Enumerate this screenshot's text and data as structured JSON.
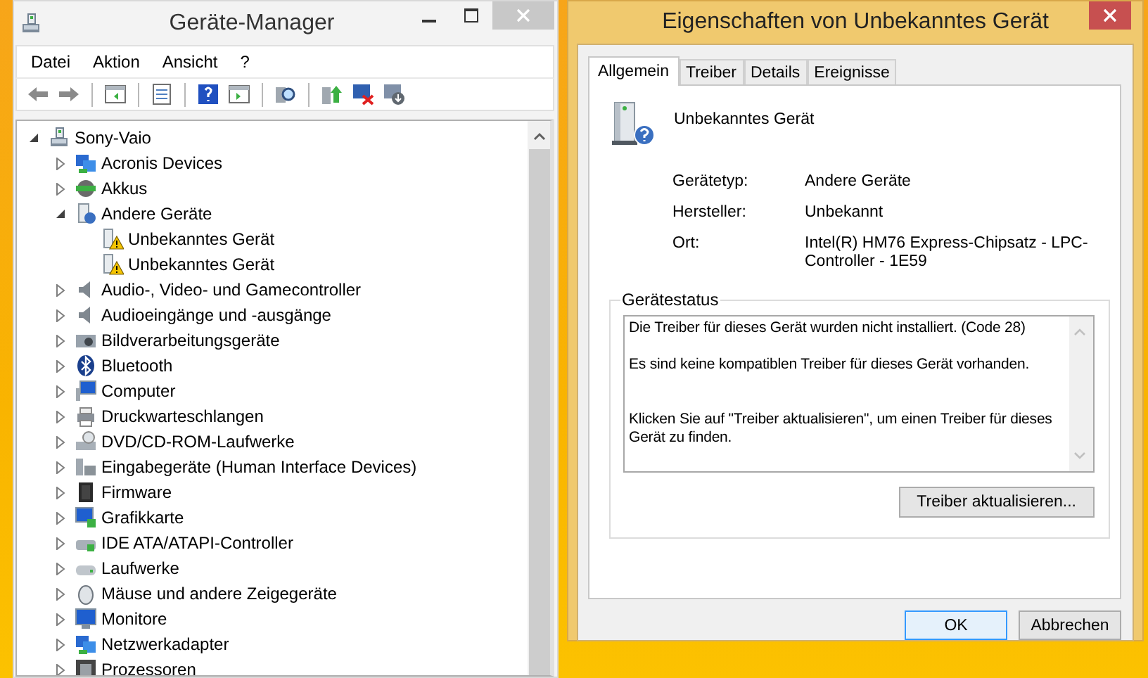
{
  "device_manager": {
    "title": "Geräte-Manager",
    "menu": [
      "Datei",
      "Aktion",
      "Ansicht",
      "?"
    ],
    "tree": [
      {
        "label": "Sony-Vaio",
        "expanded": true,
        "children": [
          {
            "label": "Acronis Devices",
            "expanded": false
          },
          {
            "label": "Akkus",
            "expanded": false
          },
          {
            "label": "Andere Geräte",
            "expanded": true,
            "children": [
              {
                "label": "Unbekanntes Gerät",
                "warning": true
              },
              {
                "label": "Unbekanntes Gerät",
                "warning": true
              }
            ]
          },
          {
            "label": "Audio-, Video- und Gamecontroller",
            "expanded": false
          },
          {
            "label": "Audioeingänge und -ausgänge",
            "expanded": false
          },
          {
            "label": "Bildverarbeitungsgeräte",
            "expanded": false
          },
          {
            "label": "Bluetooth",
            "expanded": false
          },
          {
            "label": "Computer",
            "expanded": false
          },
          {
            "label": "Druckwarteschlangen",
            "expanded": false
          },
          {
            "label": "DVD/CD-ROM-Laufwerke",
            "expanded": false
          },
          {
            "label": "Eingabegeräte (Human Interface Devices)",
            "expanded": false
          },
          {
            "label": "Firmware",
            "expanded": false
          },
          {
            "label": "Grafikkarte",
            "expanded": false
          },
          {
            "label": "IDE ATA/ATAPI-Controller",
            "expanded": false
          },
          {
            "label": "Laufwerke",
            "expanded": false
          },
          {
            "label": "Mäuse und andere Zeigegeräte",
            "expanded": false
          },
          {
            "label": "Monitore",
            "expanded": false
          },
          {
            "label": "Netzwerkadapter",
            "expanded": false
          },
          {
            "label": "Prozessoren",
            "expanded": false
          }
        ]
      }
    ]
  },
  "properties": {
    "title": "Eigenschaften von Unbekanntes Gerät",
    "tabs": [
      {
        "label": "Allgemein",
        "selected": true
      },
      {
        "label": "Treiber",
        "selected": false
      },
      {
        "label": "Details",
        "selected": false
      },
      {
        "label": "Ereignisse",
        "selected": false
      }
    ],
    "device_name": "Unbekanntes Gerät",
    "fields": [
      {
        "label": "Gerätetyp:",
        "value": "Andere Geräte"
      },
      {
        "label": "Hersteller:",
        "value": "Unbekannt"
      },
      {
        "label": "Ort:",
        "value": "Intel(R) HM76 Express-Chipsatz - LPC-Controller - 1E59"
      }
    ],
    "status_group": "Gerätestatus",
    "status_text": "Die Treiber für dieses Gerät wurden nicht installiert. (Code 28)\n\nEs sind keine kompatiblen Treiber für dieses Gerät vorhanden.\n\n\nKlicken Sie auf \"Treiber aktualisieren\", um einen Treiber für dieses Gerät zu finden.",
    "update_button": "Treiber aktualisieren...",
    "buttons": [
      {
        "label": "OK",
        "default": true
      },
      {
        "label": "Abbrechen",
        "default": false
      }
    ]
  }
}
